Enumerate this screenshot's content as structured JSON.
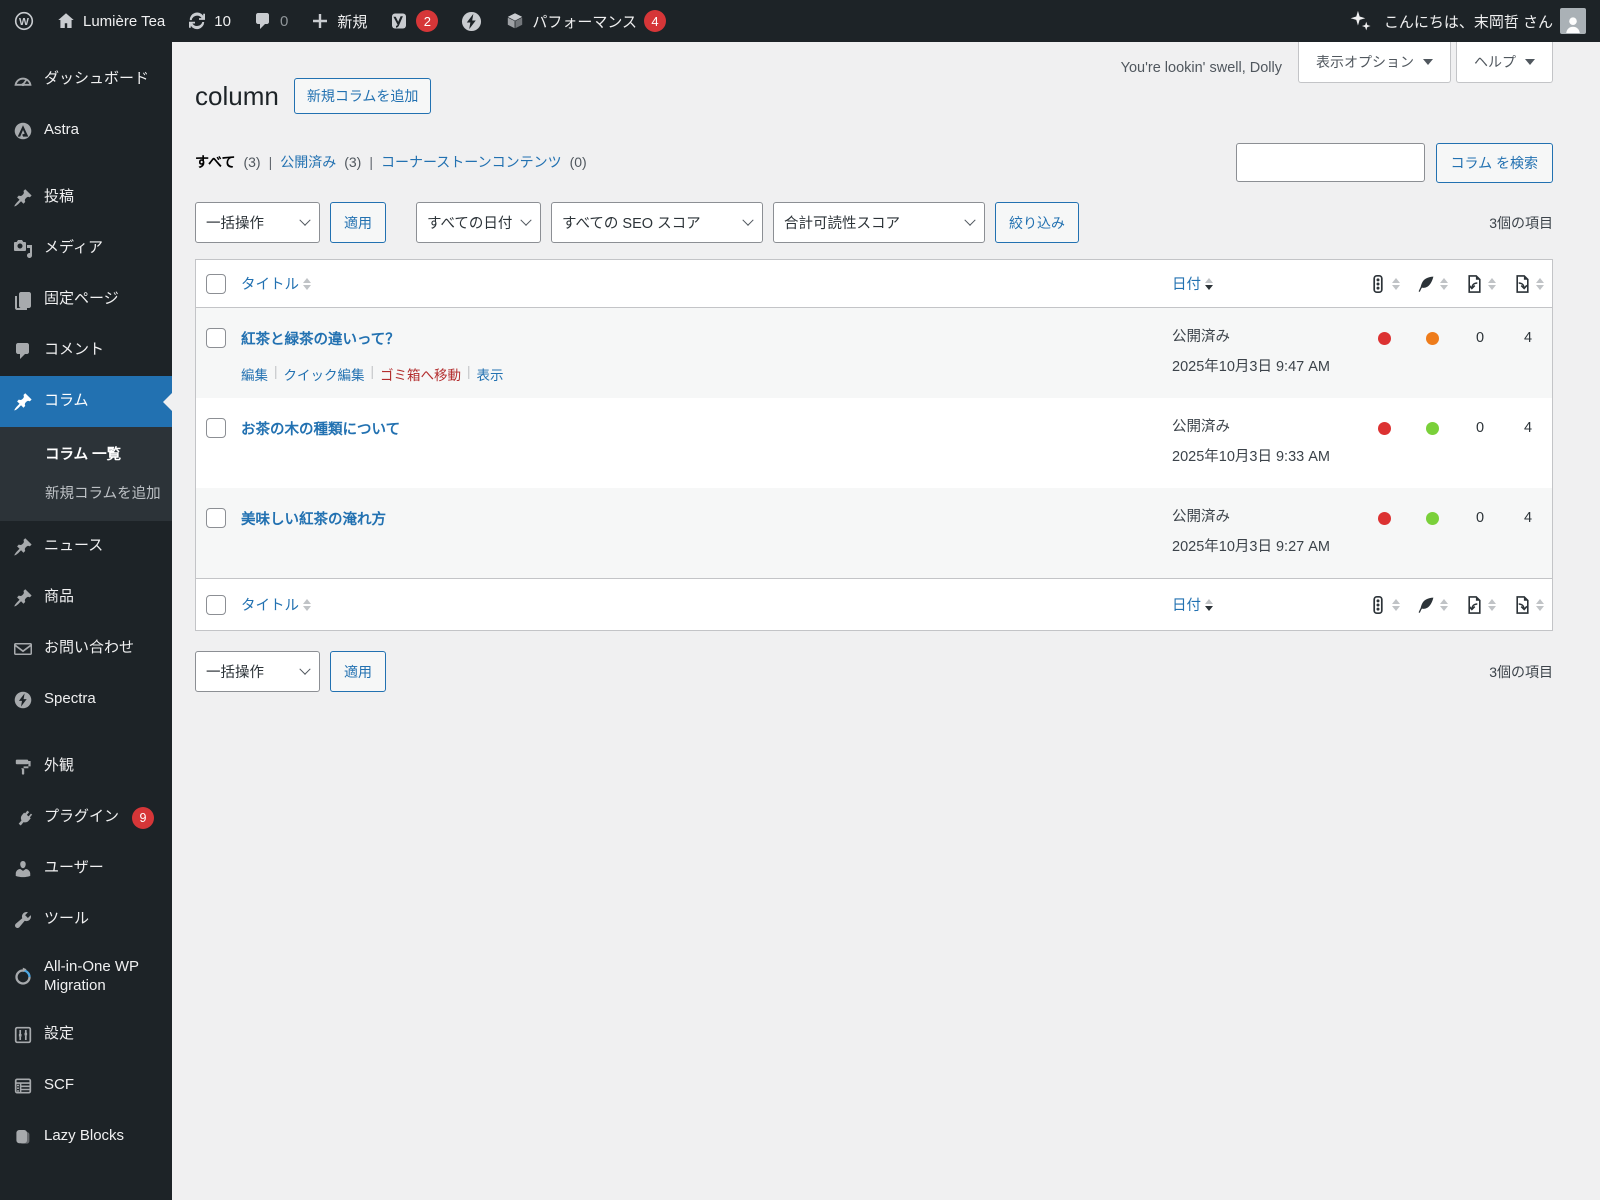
{
  "colors": {
    "red": "#dc3232",
    "orange": "#ee7c1b",
    "green": "#7ad03a",
    "accent_blue": "#2271b1",
    "badge_red": "#d63638",
    "admin_bar_bg": "#1d2327",
    "content_bg": "#f0f0f1"
  },
  "admin_bar": {
    "site_name": "Lumière Tea",
    "updates_count": "10",
    "comments_count": "0",
    "new_label": "新規",
    "yoast_badge_count": "2",
    "performance_label": "パフォーマンス",
    "performance_badge_count": "4",
    "greeting": "こんにちは、末岡哲 さん"
  },
  "sidebar": {
    "items": [
      {
        "label": "ダッシュボード"
      },
      {
        "label": "Astra"
      },
      {
        "label": "投稿"
      },
      {
        "label": "メディア"
      },
      {
        "label": "固定ページ"
      },
      {
        "label": "コメント"
      },
      {
        "label": "コラム"
      },
      {
        "label": "ニュース"
      },
      {
        "label": "商品"
      },
      {
        "label": "お問い合わせ"
      },
      {
        "label": "Spectra"
      },
      {
        "label": "外観"
      },
      {
        "label": "プラグイン",
        "badge": "9"
      },
      {
        "label": "ユーザー"
      },
      {
        "label": "ツール"
      },
      {
        "label": "All-in-One WP Migration"
      },
      {
        "label": "設定"
      },
      {
        "label": "SCF"
      },
      {
        "label": "Lazy Blocks"
      }
    ],
    "submenu": {
      "list_label": "コラム 一覧",
      "add_new_label": "新規コラムを追加"
    }
  },
  "header": {
    "dolly_text": "You're lookin' swell, Dolly",
    "screen_options_label": "表示オプション",
    "help_label": "ヘルプ",
    "page_title": "column",
    "add_new_button": "新規コラムを追加"
  },
  "views": {
    "all_label": "すべて",
    "all_count": "(3)",
    "published_label": "公開済み",
    "published_count": "(3)",
    "cornerstone_label": "コーナーストーンコンテンツ",
    "cornerstone_count": "(0)",
    "separator": "|"
  },
  "search": {
    "input_value": "",
    "button_label": "コラム を検索"
  },
  "tablenav": {
    "bulk_action_label": "一括操作",
    "apply_label": "適用",
    "date_filter_label": "すべての日付",
    "seo_filter_label": "すべての SEO スコア",
    "readability_filter_label": "合計可読性スコア",
    "filter_button_label": "絞り込み",
    "items_count": "3個の項目"
  },
  "table": {
    "columns": {
      "title": "タイトル",
      "date": "日付"
    },
    "row_actions": {
      "edit": "編集",
      "quick_edit": "クイック編集",
      "trash": "ゴミ箱へ移動",
      "view": "表示",
      "separator": "|"
    },
    "rows": [
      {
        "title": "紅茶と緑茶の違いって？",
        "status": "公開済み",
        "date": "2025年10月3日 9:47 AM",
        "seo_score": "red",
        "readability_score": "orange",
        "links_incoming": "0",
        "links_outgoing": "4"
      },
      {
        "title": "お茶の木の種類について",
        "status": "公開済み",
        "date": "2025年10月3日 9:33 AM",
        "seo_score": "red",
        "readability_score": "green",
        "links_incoming": "0",
        "links_outgoing": "4"
      },
      {
        "title": "美味しい紅茶の淹れ方",
        "status": "公開済み",
        "date": "2025年10月3日 9:27 AM",
        "seo_score": "red",
        "readability_score": "green",
        "links_incoming": "0",
        "links_outgoing": "4"
      }
    ]
  }
}
